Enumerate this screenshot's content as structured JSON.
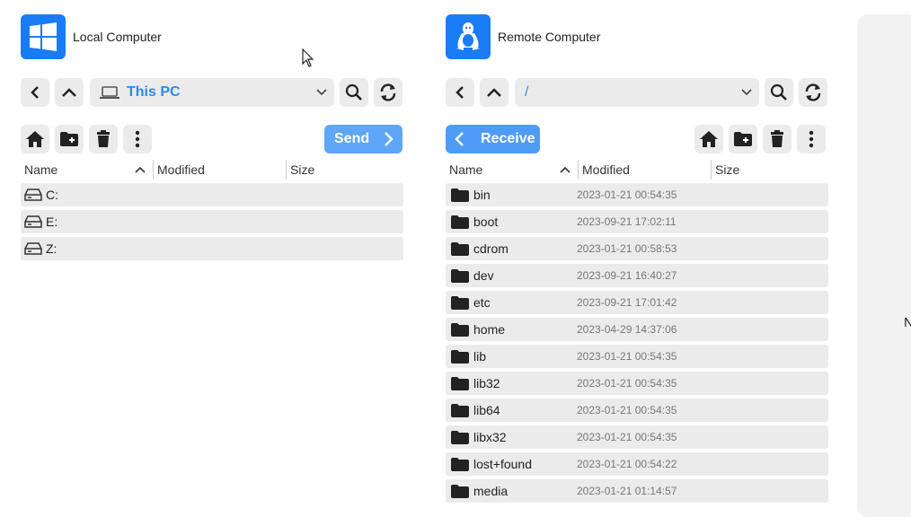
{
  "local": {
    "title": "Local Computer",
    "logo": "windows-logo",
    "path": "This PC",
    "path_icon": "laptop-icon",
    "send_label": "Send",
    "columns": {
      "name": "Name",
      "modified": "Modified",
      "size": "Size"
    },
    "files": [
      {
        "name": "C:",
        "modified": ""
      },
      {
        "name": "E:",
        "modified": ""
      },
      {
        "name": "Z:",
        "modified": ""
      }
    ]
  },
  "remote": {
    "title": "Remote Computer",
    "logo": "linux-tux-logo",
    "path": "/",
    "receive_label": "Receive",
    "columns": {
      "name": "Name",
      "modified": "Modified",
      "size": "Size"
    },
    "files": [
      {
        "name": "bin",
        "modified": "2023-01-21 00:54:35"
      },
      {
        "name": "boot",
        "modified": "2023-09-21 17:02:11"
      },
      {
        "name": "cdrom",
        "modified": "2023-01-21 00:58:53"
      },
      {
        "name": "dev",
        "modified": "2023-09-21 16:40:27"
      },
      {
        "name": "etc",
        "modified": "2023-09-21 17:01:42"
      },
      {
        "name": "home",
        "modified": "2023-04-29 14:37:06"
      },
      {
        "name": "lib",
        "modified": "2023-01-21 00:54:35"
      },
      {
        "name": "lib32",
        "modified": "2023-01-21 00:54:35"
      },
      {
        "name": "lib64",
        "modified": "2023-01-21 00:54:35"
      },
      {
        "name": "libx32",
        "modified": "2023-01-21 00:54:35"
      },
      {
        "name": "lost+found",
        "modified": "2023-01-21 00:54:22"
      },
      {
        "name": "media",
        "modified": "2023-01-21 01:14:57"
      }
    ]
  },
  "right_panel": {
    "text": "N"
  },
  "colors": {
    "accent": "#1a7cf5",
    "path_text": "#2d8ae8",
    "button_bg": "#ebebeb"
  }
}
